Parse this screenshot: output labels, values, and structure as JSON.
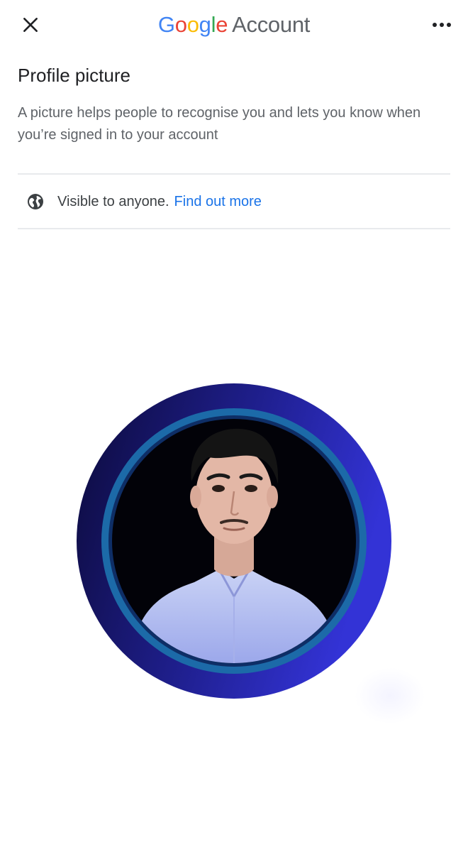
{
  "header": {
    "brand": {
      "letters": [
        "G",
        "o",
        "o",
        "g",
        "l",
        "e"
      ],
      "product": "Account"
    },
    "close_icon": "close-icon",
    "more_icon": "more-options-icon"
  },
  "page": {
    "title": "Profile picture",
    "description": "A picture helps people to recognise you and lets you know when you’re signed in to your account"
  },
  "visibility": {
    "icon": "globe-icon",
    "text": "Visible to anyone.",
    "link_label": "Find out more"
  },
  "colors": {
    "google_blue": "#4285F4",
    "google_red": "#EA4335",
    "google_yellow": "#FBBC05",
    "google_green": "#34A853",
    "link": "#1a73e8",
    "avatar_ring_outer": "#2a2ab8",
    "avatar_ring_inner": "#1e6fb0"
  }
}
